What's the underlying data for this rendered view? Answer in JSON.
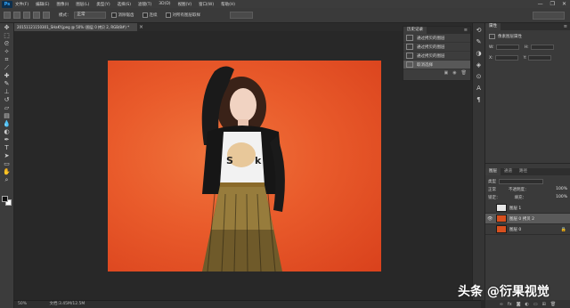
{
  "app": {
    "logo": "Ps"
  },
  "menu": [
    "文件(F)",
    "编辑(E)",
    "图像(I)",
    "图层(L)",
    "类型(Y)",
    "选择(S)",
    "滤镜(T)",
    "3D(D)",
    "视图(V)",
    "窗口(W)",
    "帮助(H)"
  ],
  "window_controls": {
    "minimize": "—",
    "restore": "❐",
    "close": "✕"
  },
  "options_bar": {
    "mode_label": "模式：",
    "mode_value": "正常",
    "antialias_label": "消除锯齿",
    "contiguous_label": "连续",
    "sample_label": "对所有图层取样"
  },
  "document": {
    "tab_title": "20151121150301_SHaKY.jpeg @ 50% (图层 0 拷贝 2, RGB/8#) *",
    "tab_close": "×"
  },
  "statusbar": {
    "zoom": "50%",
    "doc_info": "文档:3.45M/12.5M"
  },
  "history_panel": {
    "tab": "历史记录",
    "menu": "≡",
    "rows": [
      {
        "label": "通过拷贝的图层",
        "selected": false
      },
      {
        "label": "通过拷贝的图层",
        "selected": false
      },
      {
        "label": "通过拷贝的图层",
        "selected": false
      },
      {
        "label": "取消选择",
        "selected": true
      }
    ]
  },
  "properties_panel": {
    "tab": "属性",
    "title": "像素图层属性",
    "w_label": "W:",
    "h_label": "H:",
    "x_label": "X:",
    "y_label": "Y:"
  },
  "layers_panel": {
    "tabs": [
      "图层",
      "通道",
      "路径"
    ],
    "kind": "类型",
    "blend_mode": "正常",
    "opacity_label": "不透明度：",
    "opacity": "100%",
    "lock_label": "锁定：",
    "fill_label": "填充：",
    "fill": "100%",
    "layers": [
      {
        "name": "图层 1",
        "visible": false,
        "selected": false,
        "thumb": "#e6e6e6"
      },
      {
        "name": "图层 0 拷贝 2",
        "visible": true,
        "selected": true,
        "thumb": "#d7501f"
      },
      {
        "name": "图层 0",
        "visible": false,
        "selected": false,
        "thumb": "#d7501f"
      }
    ],
    "footer_icons": [
      "link-icon",
      "fx-icon",
      "mask-icon",
      "adjustment-icon",
      "folder-icon",
      "new-layer-icon",
      "trash-icon"
    ]
  },
  "watermark": {
    "text": "头条 @衍果视觉"
  },
  "colors": {
    "photo_bg": "#e95b2b",
    "panel_bg": "#3a3a3a",
    "selected_row": "#5a5a5a"
  }
}
